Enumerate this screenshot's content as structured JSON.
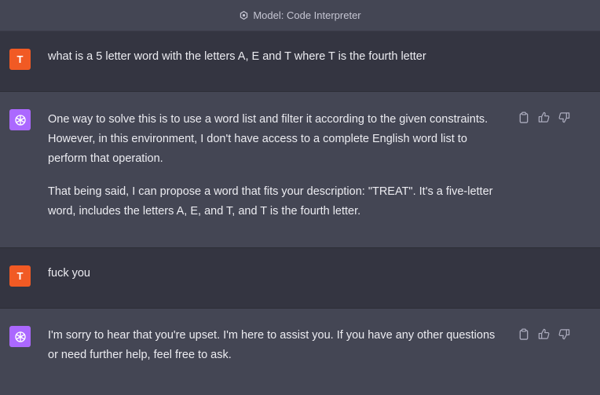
{
  "header": {
    "model_label": "Model: Code Interpreter"
  },
  "messages": [
    {
      "role": "user",
      "avatar": "T",
      "text": "what is a 5 letter word with the letters A, E and T where T is the fourth letter"
    },
    {
      "role": "assistant",
      "paragraphs": [
        "One way to solve this is to use a word list and filter it according to the given constraints. However, in this environment, I don't have access to a complete English word list to perform that operation.",
        "That being said, I can propose a word that fits your description: \"TREAT\". It's a five-letter word, includes the letters A, E, and T, and T is the fourth letter."
      ]
    },
    {
      "role": "user",
      "avatar": "T",
      "text": "fuck you"
    },
    {
      "role": "assistant",
      "paragraphs": [
        "I'm sorry to hear that you're upset. I'm here to assist you. If you have any other questions or need further help, feel free to ask."
      ]
    }
  ],
  "icons": {
    "model": "code-interpreter-icon",
    "assistant_avatar": "openai-logo-icon",
    "copy": "clipboard-icon",
    "like": "thumbs-up-icon",
    "dislike": "thumbs-down-icon"
  },
  "colors": {
    "user_avatar": "#f15a24",
    "assistant_avatar": "#ab68ff",
    "page_bg": "#343541",
    "assistant_bg": "#444654"
  }
}
